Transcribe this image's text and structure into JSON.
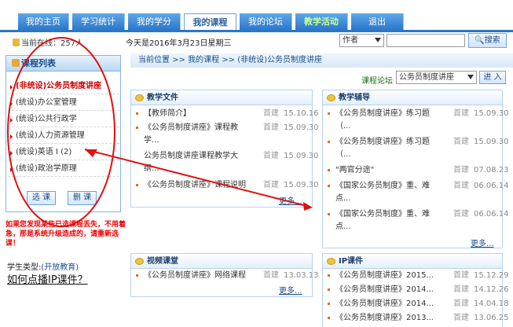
{
  "nav": {
    "tabs": [
      "我的主页",
      "学习统计",
      "我的学分",
      "我的课程",
      "我的论坛",
      "教学活动",
      "退出"
    ]
  },
  "info": {
    "online": "当前在线：257人",
    "today": "今天是2016年3月23日星期三",
    "search_field": "作者",
    "search_button": "搜索"
  },
  "sidebar": {
    "title": "课程列表",
    "items": [
      "(非统设)公务员制度讲座",
      "(统设)办公室管理",
      "(统设)公共行政学",
      "(统设)人力资源管理",
      "(统设)英语 I (2)",
      "(统设)政治学原理"
    ],
    "select_btn": "选 课",
    "delete_btn": "删 课"
  },
  "notice": "如果您发现某些已选课程丢失，不用着急，那是系统升级造成的，请重新选课！",
  "student_type_label": "学生类型:",
  "student_type_value": "(开放教育)",
  "howto": "如何点播IP课件？",
  "breadcrumb": "当前位置 >> 我的课程 >> (非统设)公务员制度讲座",
  "forum": {
    "label": "课程论坛",
    "selected": "公务员制度讲座",
    "enter": "进 入"
  },
  "panels": {
    "docs": {
      "title": "教学文件",
      "rows": [
        {
          "t": "【教师简介】",
          "by": "首建",
          "dt": "15.10.16"
        },
        {
          "t": "《公务员制度讲座》课程教",
          "by": "首建",
          "dt": "15.09.30"
        },
        {
          "t": "学...",
          "by": "",
          "dt": ""
        },
        {
          "t": "公务员制度讲座课程教学大",
          "by": "首建",
          "dt": "15.09.30"
        },
        {
          "t": "纲...",
          "by": "",
          "dt": ""
        },
        {
          "t": "《公务员制度讲座》课程说明",
          "by": "首建",
          "dt": "15.09.30"
        }
      ],
      "more": "更多..."
    },
    "tutor": {
      "title": "教学辅导",
      "rows": [
        {
          "t": "《公务员制度讲座》练习题",
          "by": "首建",
          "dt": "15.09.30"
        },
        {
          "t": "（...",
          "by": "",
          "dt": ""
        },
        {
          "t": "《公务员制度讲座》练习题",
          "by": "首建",
          "dt": "15.09.30"
        },
        {
          "t": "（...",
          "by": "",
          "dt": ""
        },
        {
          "t": "\"两官分途\"",
          "by": "首建",
          "dt": "07.08.23"
        },
        {
          "t": "《国家公务员制度》重、难",
          "by": "首建",
          "dt": "06.06.14"
        },
        {
          "t": "点...",
          "by": "",
          "dt": ""
        },
        {
          "t": "《国家公务员制度》重、难",
          "by": "首建",
          "dt": "06.06.14"
        },
        {
          "t": "点...",
          "by": "",
          "dt": ""
        }
      ],
      "more": "更多..."
    },
    "video": {
      "title": "视频课堂",
      "rows": [
        {
          "t": "《公务员制度讲座》网络课程",
          "by": "首建",
          "dt": "13.03.13"
        }
      ],
      "more": "更多..."
    },
    "ip": {
      "title": "IP课件",
      "rows": [
        {
          "t": "《公务员制度讲座》2015...",
          "by": "首建",
          "dt": "15.12.29"
        },
        {
          "t": "《公务员制度讲座》2014...",
          "by": "首建",
          "dt": "14.12.26"
        },
        {
          "t": "《公务员制度讲座》2014...",
          "by": "首建",
          "dt": "14.04.18"
        },
        {
          "t": "《公务员制度讲座》2013...",
          "by": "首建",
          "dt": "13.06.25"
        }
      ]
    }
  },
  "colors": {
    "nav_blue": "#2b77c9",
    "annotation_red": "#e01010",
    "link_blue": "#1a4d8c"
  }
}
